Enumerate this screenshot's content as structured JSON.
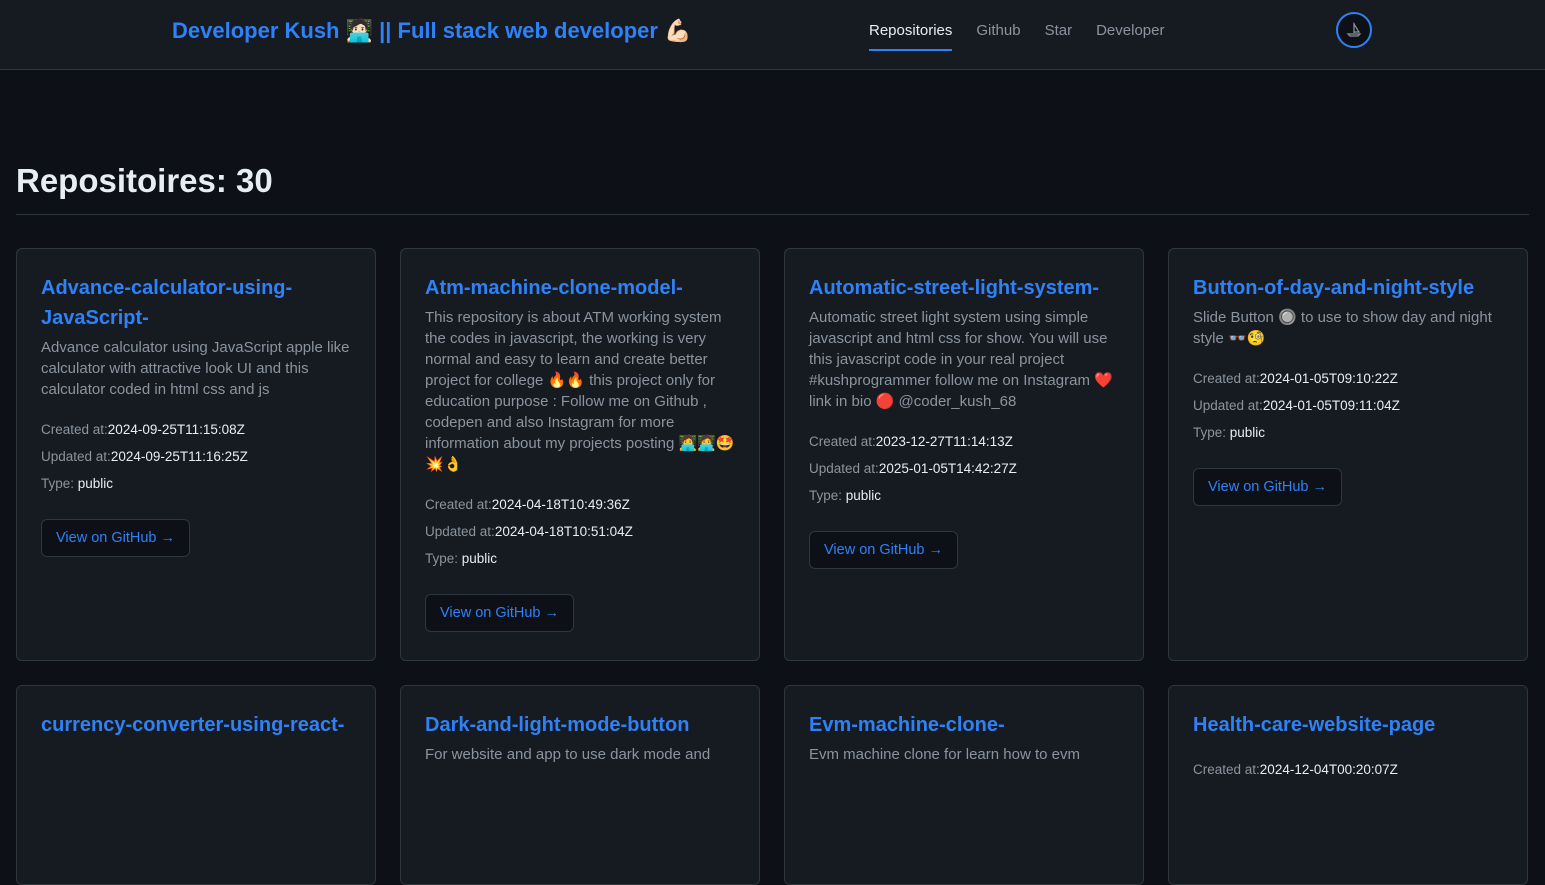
{
  "header": {
    "brand": "Developer Kush 🧑🏻‍💻 || Full stack web developer 💪🏻",
    "nav": [
      "Repositories",
      "Github",
      "Star",
      "Developer"
    ]
  },
  "main": {
    "title": "Repositoires: 30",
    "labels": {
      "created": "Created at:",
      "updated": "Updated at:",
      "type": "Type: ",
      "button": "View on GitHub →"
    },
    "repos": [
      {
        "name": "Advance-calculator-using-JavaScript-",
        "desc": "Advance calculator using JavaScript apple like calculator with attractive look UI and this calculator coded in html css and js",
        "created": "2024-09-25T11:15:08Z",
        "updated": "2024-09-25T11:16:25Z",
        "type": "public"
      },
      {
        "name": "Atm-machine-clone-model-",
        "desc": "This repository is about ATM working system the codes in javascript, the working is very normal and easy to learn and create better project for college 🔥🔥 this project only for education purpose : Follow me on Github , codepen and also Instagram for more information about my projects posting 🧑‍💻🧑‍💻🤩💥👌",
        "created": "2024-04-18T10:49:36Z",
        "updated": "2024-04-18T10:51:04Z",
        "type": "public"
      },
      {
        "name": "Automatic-street-light-system-",
        "desc": "Automatic street light system using simple javascript and html css for show. You will use this javascript code in your real project #kushprogrammer follow me on Instagram ❤️ link in bio 🔴 @coder_kush_68",
        "created": "2023-12-27T11:14:13Z",
        "updated": "2025-01-05T14:42:27Z",
        "type": "public"
      },
      {
        "name": "Button-of-day-and-night-style",
        "desc": "Slide Button 🔘 to use to show day and night style 👓🧐",
        "created": "2024-01-05T09:10:22Z",
        "updated": "2024-01-05T09:11:04Z",
        "type": "public"
      },
      {
        "name": "currency-converter-using-react-",
        "desc": "",
        "created": "",
        "updated": "",
        "type": ""
      },
      {
        "name": "Dark-and-light-mode-button",
        "desc": "For website and app to use dark mode and",
        "created": "",
        "updated": "",
        "type": ""
      },
      {
        "name": "Evm-machine-clone-",
        "desc": "Evm machine clone for learn how to evm",
        "created": "",
        "updated": "",
        "type": ""
      },
      {
        "name": "Health-care-website-page",
        "desc": "",
        "created": "2024-12-04T00:20:07Z",
        "updated": "",
        "type": ""
      }
    ]
  },
  "colors": {
    "accent": "#2f81f7",
    "background": "#0d1117",
    "card": "#161b22",
    "border": "#30363d"
  }
}
